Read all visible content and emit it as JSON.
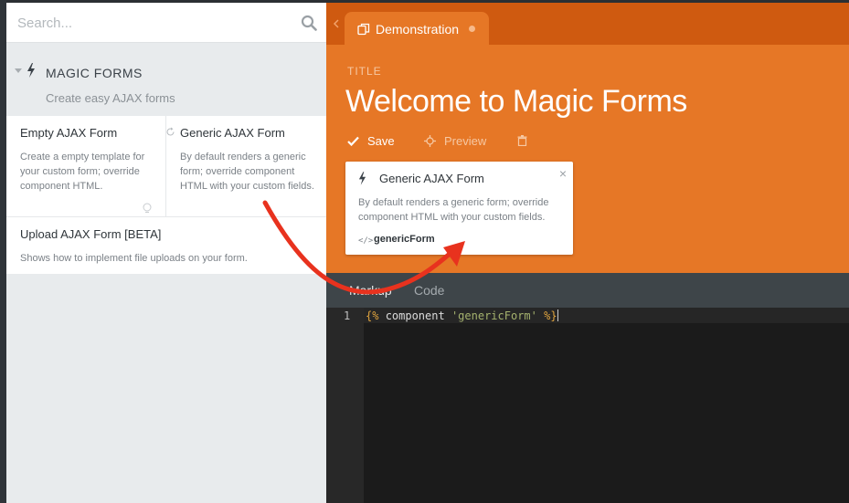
{
  "sidebar": {
    "search": {
      "placeholder": "Search..."
    },
    "group": {
      "title": "MAGIC FORMS",
      "subtitle": "Create easy AJAX forms"
    },
    "components": [
      {
        "title": "Empty AJAX Form",
        "description": "Create a empty template for your custom form; override component HTML."
      },
      {
        "title": "Generic AJAX Form",
        "description": "By default renders a generic form; override component HTML with your custom fields."
      },
      {
        "title": "Upload AJAX Form [BETA]",
        "description": "Shows how to implement file uploads on your form."
      }
    ]
  },
  "main": {
    "tab": {
      "label": "Demonstration"
    },
    "field_label": "TITLE",
    "title": "Welcome to Magic Forms",
    "toolbar": {
      "save_label": "Save",
      "preview_label": "Preview"
    },
    "component_card": {
      "title": "Generic AJAX Form",
      "description": "By default renders a generic form; override component HTML with your custom fields.",
      "alias": "genericForm",
      "close_symbol": "×"
    }
  },
  "editor": {
    "tabs": [
      "Markup",
      "Code"
    ],
    "active_tab": "Markup",
    "lines": [
      {
        "number": "1",
        "open": "{%",
        "keyword": "component",
        "string": "'genericForm'",
        "close": "%}"
      }
    ]
  },
  "colors": {
    "accent_orange": "#e67726",
    "tab_bar": "#cf5a10",
    "arrow_red": "#e8321e"
  },
  "icons": {
    "search": "search-icon",
    "bolt": "bolt-icon",
    "save": "checkmark-icon",
    "preview": "crosshair-icon",
    "delete": "trash-icon",
    "tab": "copy-icon",
    "code": "code-icon"
  }
}
